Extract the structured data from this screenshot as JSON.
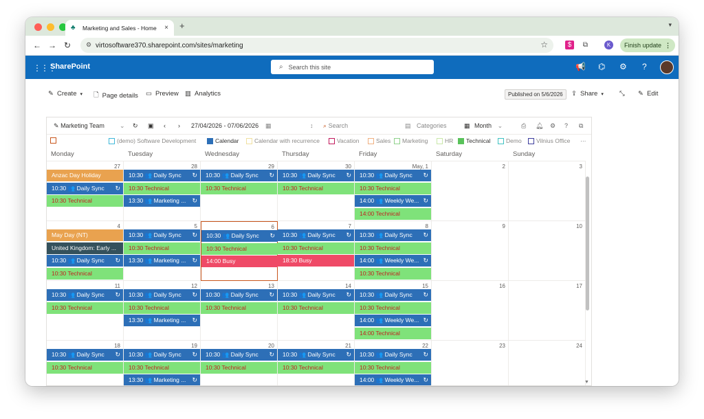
{
  "browser": {
    "tab_title": "Marketing and Sales - Home",
    "tab_close": "×",
    "new_tab": "+",
    "url": "virtosoftware370.sharepoint.com/sites/marketing",
    "profile_initial": "K",
    "finish_update": "Finish update",
    "colors": {
      "close": "#ff5f57",
      "min": "#febc2e",
      "max": "#28c840"
    }
  },
  "sharepoint": {
    "app_name": "SharePoint",
    "search_placeholder": "Search this site",
    "accent": "#0f6cbd"
  },
  "commandbar": {
    "create": "Create",
    "page_details": "Page details",
    "preview": "Preview",
    "analytics": "Analytics",
    "published": "Published on 5/6/2026",
    "share": "Share",
    "edit": "Edit"
  },
  "calendar": {
    "toolbar": {
      "team": "Marketing Team",
      "range": "27/04/2026 - 07/06/2026",
      "search": "Search",
      "categories": "Categories",
      "view": "Month"
    },
    "legend": [
      {
        "label": "(demo) Software Development",
        "color": "#3fb8d9",
        "filled": false
      },
      {
        "label": "Calendar",
        "color": "#2d6fb7",
        "filled": true
      },
      {
        "label": "Calendar with recurrence",
        "color": "#f0e0a0",
        "filled": false
      },
      {
        "label": "Vacation",
        "color": "#c2185b",
        "filled": false
      },
      {
        "label": "Sales",
        "color": "#f0b080",
        "filled": false
      },
      {
        "label": "Marketing",
        "color": "#8fd18a",
        "filled": false
      },
      {
        "label": "HR",
        "color": "#c9e7a8",
        "filled": false
      },
      {
        "label": "Technical",
        "color": "#59c25a",
        "filled": true
      },
      {
        "label": "Demo",
        "color": "#3fc2c2",
        "filled": false
      },
      {
        "label": "Vilnius Office",
        "color": "#3c3c9c",
        "filled": false
      }
    ],
    "more": "···",
    "days": [
      "Monday",
      "Tuesday",
      "Wednesday",
      "Thursday",
      "Friday",
      "Saturday",
      "Sunday"
    ],
    "weeks": [
      {
        "dates": [
          "27",
          "28",
          "29",
          "30",
          "May, 1",
          "2",
          "3"
        ],
        "events": [
          [
            {
              "text": "Anzac Day Holiday",
              "type": "orange"
            },
            {
              "text": "10:30 👥 Daily Sync",
              "type": "blue",
              "rec": true
            },
            {
              "text": "10:30 Technical",
              "type": "green"
            }
          ],
          [
            {
              "text": "10:30 👥 Daily Sync",
              "type": "blue",
              "rec": true
            },
            {
              "text": "10:30 Technical",
              "type": "green"
            },
            {
              "text": "13:30 👥 Marketing ...",
              "type": "blue",
              "rec": true
            }
          ],
          [
            {
              "text": "10:30 👥 Daily Sync",
              "type": "blue",
              "rec": true
            },
            {
              "text": "10:30 Technical",
              "type": "green"
            }
          ],
          [
            {
              "text": "10:30 👥 Daily Sync",
              "type": "blue",
              "rec": true
            },
            {
              "text": "10:30 Technical",
              "type": "green"
            }
          ],
          [
            {
              "text": "10:30 👥 Daily Sync",
              "type": "blue",
              "rec": true
            },
            {
              "text": "10:30 Technical",
              "type": "green"
            },
            {
              "text": "14:00 👥 Weekly We...",
              "type": "blue",
              "rec": true
            },
            {
              "text": "14:00 Technical",
              "type": "green"
            }
          ],
          [],
          []
        ]
      },
      {
        "dates": [
          "4",
          "5",
          "6",
          "7",
          "8",
          "9",
          "10"
        ],
        "today_index": 2,
        "events": [
          [
            {
              "text": "May Day (NT)",
              "type": "orange"
            },
            {
              "text": "United Kingdom: Early ...",
              "type": "dark"
            },
            {
              "text": "10:30 👥 Daily Sync",
              "type": "blue",
              "rec": true
            },
            {
              "text": "10:30 Technical",
              "type": "green"
            }
          ],
          [
            {
              "text": "10:30 👥 Daily Sync",
              "type": "blue",
              "rec": true
            },
            {
              "text": "10:30 Technical",
              "type": "green"
            },
            {
              "text": "13:30 👥 Marketing ...",
              "type": "blue",
              "rec": true
            }
          ],
          [
            {
              "text": "10:30 👥 Daily Sync",
              "type": "blue",
              "rec": true
            },
            {
              "text": "10:30 Technical",
              "type": "green"
            },
            {
              "text": "14:00 Busy",
              "type": "red"
            }
          ],
          [
            {
              "text": "10:30 👥 Daily Sync",
              "type": "blue",
              "rec": true
            },
            {
              "text": "10:30 Technical",
              "type": "green"
            },
            {
              "text": "18:30 Busy",
              "type": "red"
            }
          ],
          [
            {
              "text": "10:30 👥 Daily Sync",
              "type": "blue",
              "rec": true
            },
            {
              "text": "10:30 Technical",
              "type": "green"
            },
            {
              "text": "14:00 👥 Weekly We...",
              "type": "blue",
              "rec": true
            },
            {
              "text": "10:30 Technical",
              "type": "green"
            }
          ],
          [],
          []
        ]
      },
      {
        "dates": [
          "11",
          "12",
          "13",
          "14",
          "15",
          "16",
          "17"
        ],
        "events": [
          [
            {
              "text": "10:30 👥 Daily Sync",
              "type": "blue",
              "rec": true
            },
            {
              "text": "10:30 Technical",
              "type": "green"
            }
          ],
          [
            {
              "text": "10:30 👥 Daily Sync",
              "type": "blue",
              "rec": true
            },
            {
              "text": "10:30 Technical",
              "type": "green"
            },
            {
              "text": "13:30 👥 Marketing ...",
              "type": "blue",
              "rec": true
            }
          ],
          [
            {
              "text": "10:30 👥 Daily Sync",
              "type": "blue",
              "rec": true
            },
            {
              "text": "10:30 Technical",
              "type": "green"
            }
          ],
          [
            {
              "text": "10:30 👥 Daily Sync",
              "type": "blue",
              "rec": true
            },
            {
              "text": "10:30 Technical",
              "type": "green"
            }
          ],
          [
            {
              "text": "10:30 👥 Daily Sync",
              "type": "blue",
              "rec": true
            },
            {
              "text": "10:30 Technical",
              "type": "green"
            },
            {
              "text": "14:00 👥 Weekly We...",
              "type": "blue",
              "rec": true
            },
            {
              "text": "14:00 Technical",
              "type": "green"
            }
          ],
          [],
          []
        ]
      },
      {
        "dates": [
          "18",
          "19",
          "20",
          "21",
          "22",
          "23",
          "24"
        ],
        "events": [
          [
            {
              "text": "10:30 👥 Daily Sync",
              "type": "blue",
              "rec": true
            },
            {
              "text": "10:30 Technical",
              "type": "green"
            }
          ],
          [
            {
              "text": "10:30 👥 Daily Sync",
              "type": "blue",
              "rec": true
            },
            {
              "text": "10:30 Technical",
              "type": "green"
            },
            {
              "text": "13:30 👥 Marketing ...",
              "type": "blue",
              "rec": true
            }
          ],
          [
            {
              "text": "10:30 👥 Daily Sync",
              "type": "blue",
              "rec": true
            },
            {
              "text": "10:30 Technical",
              "type": "green"
            }
          ],
          [
            {
              "text": "10:30 👥 Daily Sync",
              "type": "blue",
              "rec": true
            },
            {
              "text": "10:30 Technical",
              "type": "green"
            }
          ],
          [
            {
              "text": "10:30 👥 Daily Sync",
              "type": "blue",
              "rec": true
            },
            {
              "text": "10:30 Technical",
              "type": "green"
            },
            {
              "text": "14:00 👥 Weekly We...",
              "type": "blue",
              "rec": true
            }
          ],
          [],
          []
        ]
      }
    ]
  }
}
